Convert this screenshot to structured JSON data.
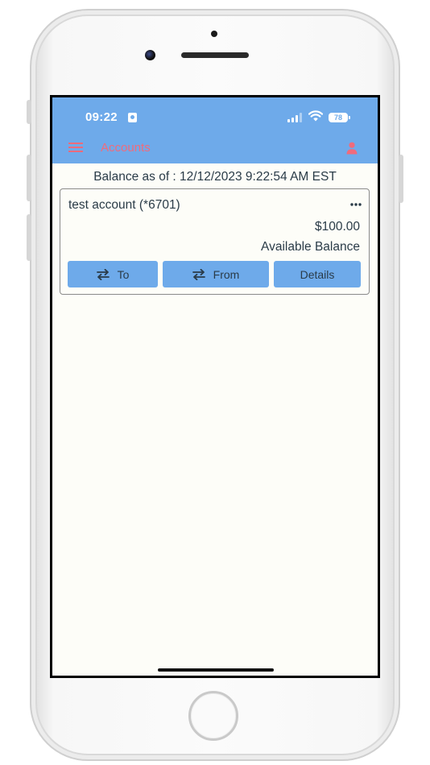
{
  "status_bar": {
    "time": "09:22",
    "battery": "78"
  },
  "header": {
    "title": "Accounts",
    "menu_icon": "hamburger-menu-icon",
    "user_icon": "user-icon"
  },
  "balance_as_of": "Balance as of : 12/12/2023 9:22:54 AM EST",
  "account": {
    "name": "test account (*6701)",
    "amount": "$100.00",
    "amount_label": "Available Balance",
    "buttons": {
      "to": "To",
      "from": "From",
      "details": "Details"
    }
  },
  "colors": {
    "header_bg": "#6eaaea",
    "accent": "#f06b7c",
    "text": "#2a3b48",
    "screen_bg": "#fdfdf8"
  }
}
